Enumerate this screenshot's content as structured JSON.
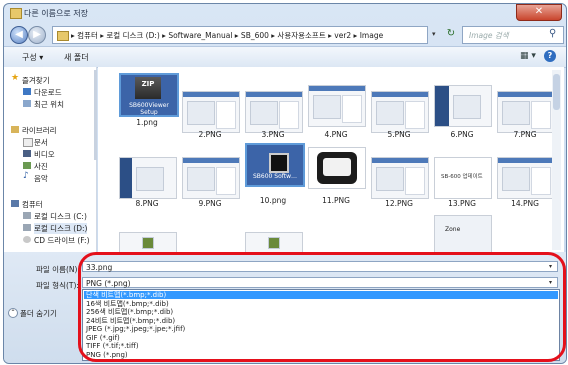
{
  "window": {
    "title": "다른 이름으로 저장",
    "close_glyph": "✕"
  },
  "address_bar": {
    "path": "▸ 컴퓨터 ▸ 로컬 디스크 (D:) ▸ Software_Manual ▸ SB_600 ▸ 사용자용소프트 ▸ ver2 ▸ Image",
    "dropdown_glyph": "▾",
    "refresh_glyph": "↻",
    "search_placeholder": "Image 검색",
    "search_glyph": "⚲",
    "back_glyph": "◀",
    "forward_glyph": "▶"
  },
  "toolbar": {
    "organize": "구성 ▾",
    "new_folder": "새 폴더",
    "view_glyph": "▦ ▾",
    "help_glyph": "?"
  },
  "nav": {
    "favorites": "즐겨찾기",
    "downloads": "다운로드",
    "recent": "최근 위치",
    "libraries": "라이브러리",
    "documents": "문서",
    "videos": "비디오",
    "pictures": "사진",
    "music": "음악",
    "computer": "컴퓨터",
    "drive_c": "로컬 디스크 (C:)",
    "drive_d": "로컬 디스크 (D:)",
    "drive_f": "CD 드라이브 (F:)"
  },
  "files": [
    {
      "name": "1.png",
      "zip_label": "ZIP",
      "caption": "SB600Viewer Setup"
    },
    {
      "name": "2.PNG"
    },
    {
      "name": "3.PNG"
    },
    {
      "name": "4.PNG"
    },
    {
      "name": "5.PNG"
    },
    {
      "name": "6.PNG"
    },
    {
      "name": "7.PNG"
    },
    {
      "name": "8.PNG"
    },
    {
      "name": "9.PNG"
    },
    {
      "name": "10.png",
      "caption": "SB600 Softw…"
    },
    {
      "name": "11.PNG"
    },
    {
      "name": "12.PNG"
    },
    {
      "name": "13.PNG",
      "caption": "SB-600 업데이트"
    },
    {
      "name": "14.PNG",
      "caption": "Zone"
    }
  ],
  "save_panel": {
    "filename_label": "파일 이름(N):",
    "filename_value": "33.png",
    "filetype_label": "파일 형식(T):",
    "filetype_value": "PNG (*.png)",
    "arrow_glyph": "▾",
    "hide_folders": "폴더 숨기기",
    "hide_glyph": "⌃"
  },
  "filetype_options": [
    "단색 비트맵(*.bmp;*.dib)",
    "16색 비트맵(*.bmp;*.dib)",
    "256색 비트맵(*.bmp;*.dib)",
    "24비트 비트맵(*.bmp;*.dib)",
    "JPEG (*.jpg;*.jpeg;*.jpe;*.jfif)",
    "GIF (*.gif)",
    "TIFF (*.tif;*.tiff)",
    "PNG (*.png)"
  ],
  "colors": {
    "highlight": "#e4101b",
    "selection": "#3399ff",
    "frame": "#c4d6ec"
  }
}
